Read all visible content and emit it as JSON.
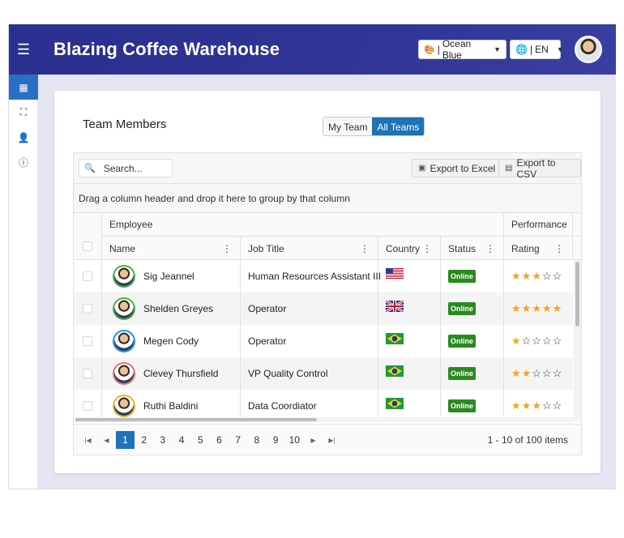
{
  "app": {
    "title": "Blazing Coffee Warehouse"
  },
  "header": {
    "theme_label": "Ocean Blue",
    "lang_label": "EN"
  },
  "sidebar": {
    "items": [
      {
        "icon": "grid-icon",
        "glyph": "▦"
      },
      {
        "icon": "chart-icon",
        "glyph": "⛶"
      },
      {
        "icon": "user-icon",
        "glyph": "👤"
      },
      {
        "icon": "info-icon",
        "glyph": "ⓘ"
      }
    ]
  },
  "card": {
    "title": "Team Members",
    "tabs": [
      "My Team",
      "All Teams"
    ],
    "active_tab": "All Teams"
  },
  "grid": {
    "search_placeholder": "Search...",
    "export_excel": "Export to Excel",
    "export_csv": "Export to CSV",
    "group_hint": "Drag a column header and drop it here to group by that column",
    "group_headers": {
      "employee": "Employee",
      "performance": "Performance"
    },
    "columns": {
      "name": "Name",
      "job": "Job Title",
      "country": "Country",
      "status": "Status",
      "rating": "Rating"
    },
    "rows": [
      {
        "name": "Sig Jeannel",
        "job": "Human Resources Assistant III",
        "country": "US",
        "status": "Online",
        "rating": 3,
        "avatar_color": "#4caf50"
      },
      {
        "name": "Shelden Greyes",
        "job": "Operator",
        "country": "GB",
        "status": "Online",
        "rating": 5,
        "avatar_color": "#4caf50"
      },
      {
        "name": "Megen Cody",
        "job": "Operator",
        "country": "BR",
        "status": "Online",
        "rating": 1,
        "avatar_color": "#2196f3"
      },
      {
        "name": "Clevey Thursfield",
        "job": "VP Quality Control",
        "country": "BR",
        "status": "Online",
        "rating": 2,
        "avatar_color": "#e57373"
      },
      {
        "name": "Ruthi Baldini",
        "job": "Data Coordiator",
        "country": "BR",
        "status": "Online",
        "rating": 3,
        "avatar_color": "#f0b429"
      }
    ],
    "pager": {
      "pages": [
        "1",
        "2",
        "3",
        "4",
        "5",
        "6",
        "7",
        "8",
        "9",
        "10"
      ],
      "current": "1",
      "info": "1 - 10 of 100 items"
    }
  },
  "colors": {
    "header_bg": "#2b2f8f",
    "accent": "#1f73b7",
    "status_online": "#2a8a1f",
    "star": "#f0a516"
  }
}
